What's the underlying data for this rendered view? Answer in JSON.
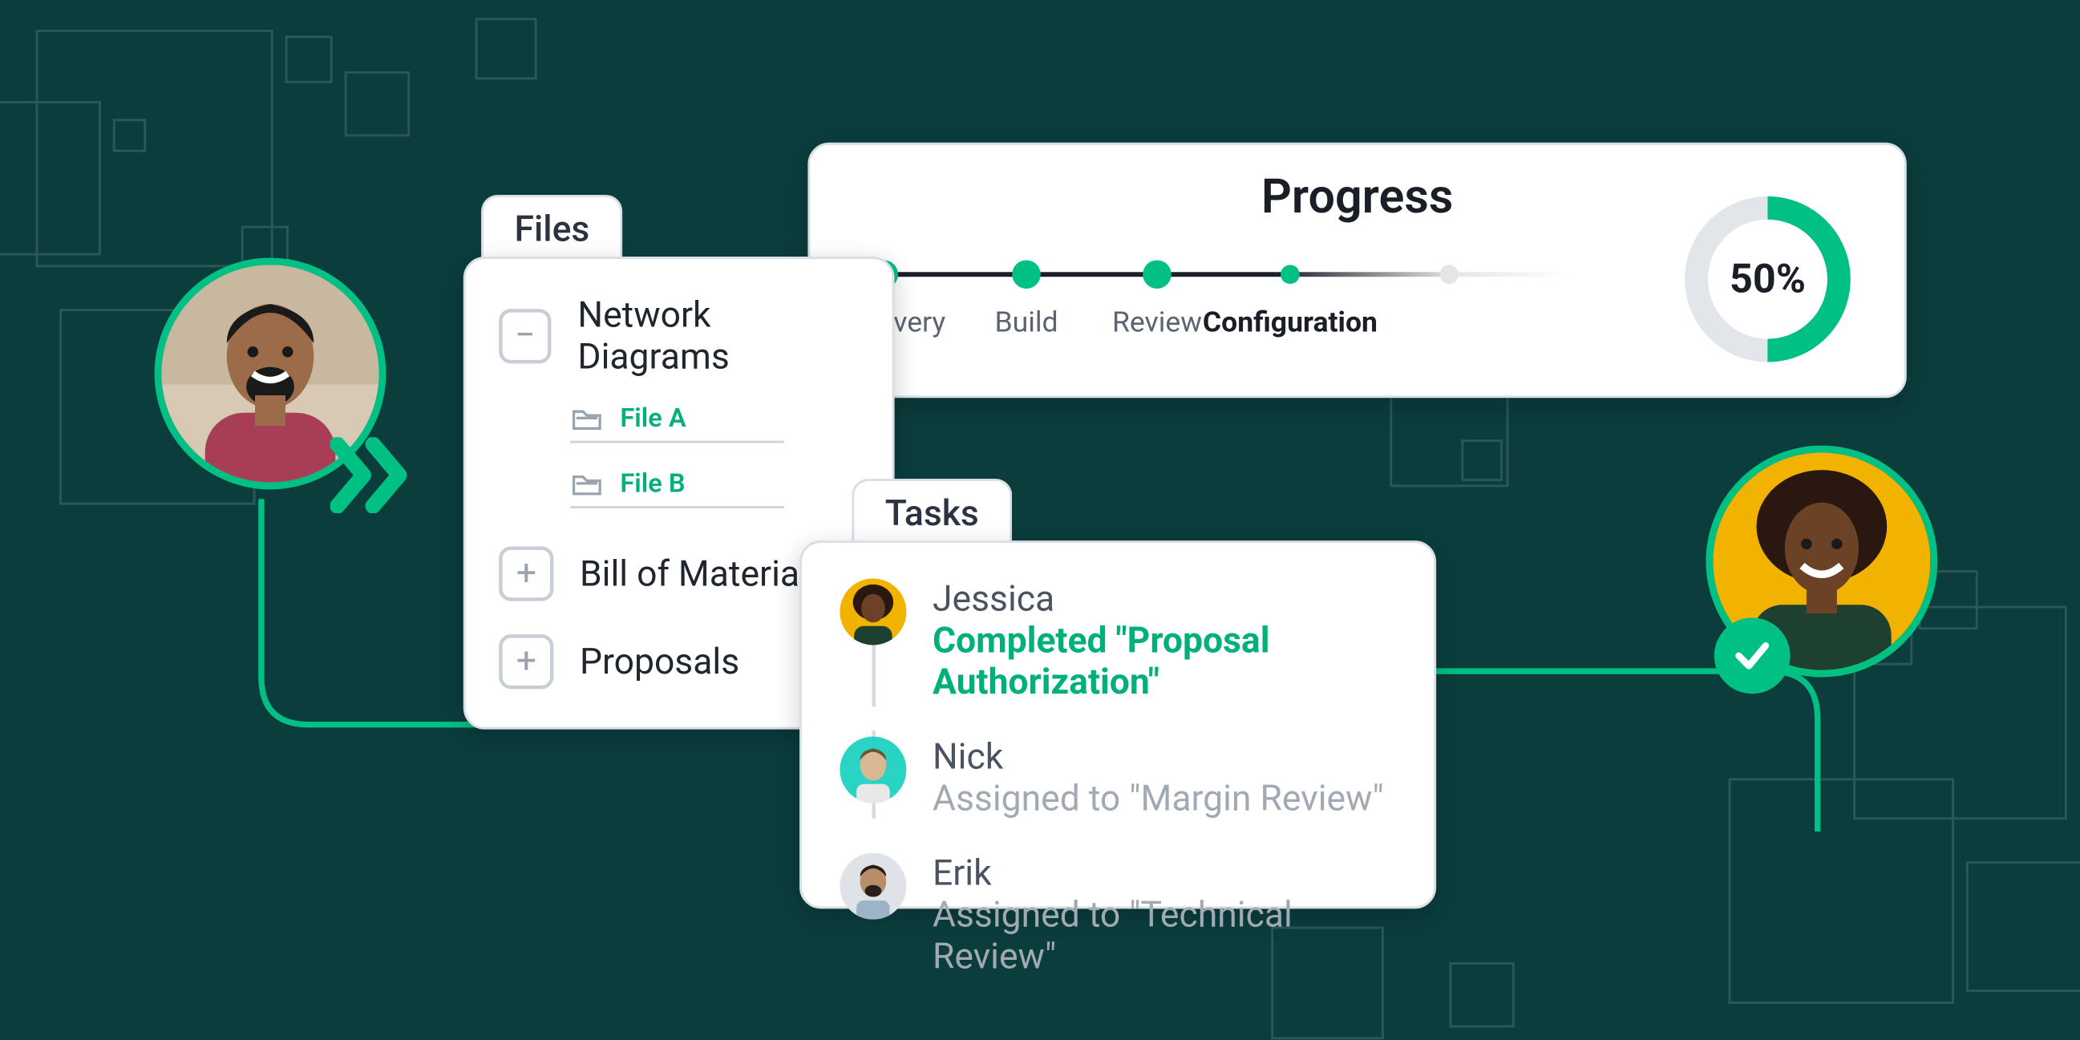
{
  "files": {
    "tab": "Files",
    "items": [
      {
        "label": "Network Diagrams",
        "expand": "−",
        "children": [
          {
            "label": "File A"
          },
          {
            "label": "File B"
          }
        ]
      },
      {
        "label": "Bill of Materials",
        "expand": "+"
      },
      {
        "label": "Proposals",
        "expand": "+"
      }
    ]
  },
  "progress": {
    "title": "Progress",
    "steps": [
      "Discovery",
      "Build",
      "Review",
      "Configuration"
    ],
    "active_index": 3,
    "percent_label": "50%",
    "percent": 50
  },
  "tasks": {
    "tab": "Tasks",
    "items": [
      {
        "name": "Jessica",
        "status": "Completed \"Proposal Authorization\"",
        "done": true,
        "avatar_bg": "#f2b200"
      },
      {
        "name": "Nick",
        "status": "Assigned to \"Margin Review\"",
        "done": false,
        "avatar_bg": "#2ad4c4"
      },
      {
        "name": "Erik",
        "status": "Assigned to \"Technical Review\"",
        "done": false,
        "avatar_bg": "#dfe3e8"
      }
    ]
  },
  "people": {
    "left_alt": "Team member portrait left",
    "right_alt": "Team member portrait right"
  },
  "colors": {
    "accent": "#00c084",
    "bg": "#0b3d3d"
  }
}
